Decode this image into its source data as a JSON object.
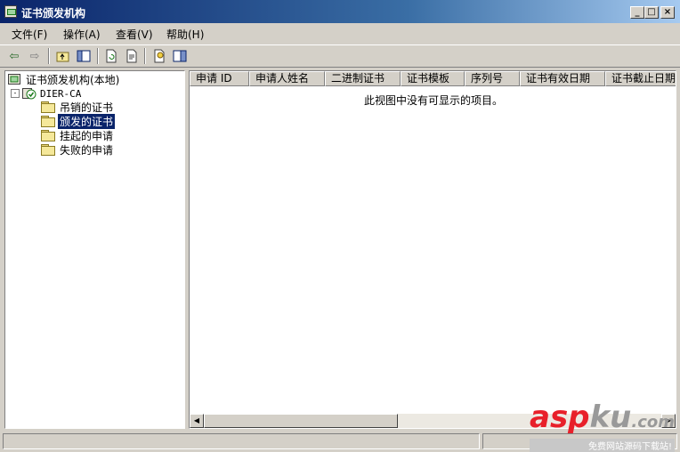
{
  "window": {
    "title": "证书颁发机构",
    "controls": [
      "minimize",
      "maximize",
      "close"
    ]
  },
  "menu": {
    "items": [
      {
        "label": "文件(F)"
      },
      {
        "label": "操作(A)"
      },
      {
        "label": "查看(V)"
      },
      {
        "label": "帮助(H)"
      }
    ]
  },
  "toolbar": {
    "buttons": [
      "back-icon",
      "forward-icon",
      "up-level-icon",
      "show-hide-tree-icon",
      "refresh-icon",
      "export-list-icon",
      "properties-icon",
      "help-icon"
    ]
  },
  "tree": {
    "root": "证书颁发机构(本地)",
    "ca_node": "DIER-CA",
    "expander": "-",
    "folders": [
      {
        "label": "吊销的证书",
        "selected": false
      },
      {
        "label": "颁发的证书",
        "selected": true
      },
      {
        "label": "挂起的申请",
        "selected": false
      },
      {
        "label": "失败的申请",
        "selected": false
      }
    ]
  },
  "list": {
    "columns": [
      "申请 ID",
      "申请人姓名",
      "二进制证书",
      "证书模板",
      "序列号",
      "证书有效日期",
      "证书截止日期"
    ],
    "empty_message": "此视图中没有可显示的项目。"
  },
  "watermark": {
    "asp": "asp",
    "ku": "ku",
    "com": ".com",
    "sub": "免费网站源码下载站!"
  }
}
